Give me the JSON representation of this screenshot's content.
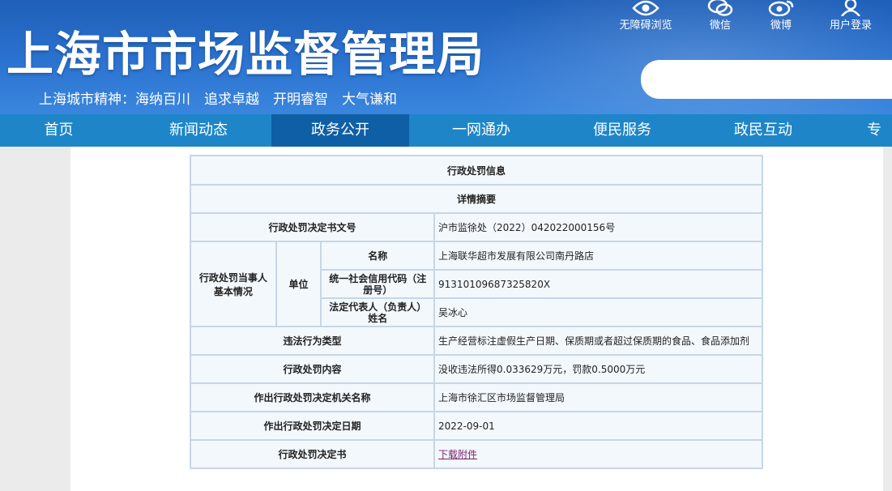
{
  "header": {
    "title": "上海市市场监督管理局",
    "motto": "上海城市精神：海纳百川　追求卓越　开明睿智　大气谦和",
    "tools": [
      {
        "icon": "eye-icon",
        "label": "无障碍浏览"
      },
      {
        "icon": "wechat-icon",
        "label": "微信"
      },
      {
        "icon": "weibo-icon",
        "label": "微博"
      },
      {
        "icon": "user-icon",
        "label": "用户登录"
      }
    ],
    "search_placeholder": ""
  },
  "nav": {
    "items": [
      "首页",
      "新闻动态",
      "政务公开",
      "一网通办",
      "便民服务",
      "政民互动",
      "专"
    ],
    "active": "政务公开"
  },
  "table": {
    "title": "行政处罚信息",
    "subtitle": "详情摘要",
    "rows": {
      "doc_no_label": "行政处罚决定书文号",
      "doc_no_value": "沪市监徐处（2022）042022000156号",
      "party_label": "行政处罚当事人基本情况",
      "unit_label": "单位",
      "name_label": "名称",
      "name_value": "上海联华超市发展有限公司南丹路店",
      "credit_label": "统一社会信用代码（注册号）",
      "credit_value": "91310109687325820X",
      "rep_label": "法定代表人（负责人）姓名",
      "rep_value": "吴冰心",
      "violation_label": "违法行为类型",
      "violation_value": "生产经营标注虚假生产日期、保质期或者超过保质期的食品、食品添加剂",
      "content_label": "行政处罚内容",
      "content_value": "没收违法所得0.033629万元，罚款0.5000万元",
      "authority_label": "作出行政处罚决定机关名称",
      "authority_value": "上海市徐汇区市场监督管理局",
      "date_label": "作出行政处罚决定日期",
      "date_value": "2022-09-01",
      "doc_label": "行政处罚决定书",
      "doc_value": "下载附件"
    }
  },
  "colors": {
    "header_blue": "#2b73d0",
    "nav_blue": "#1e86c8",
    "nav_active": "#0f5fa6",
    "table_border": "#c7d6e4",
    "table_bg": "#f3f8fd",
    "link": "#7b1f6b"
  }
}
